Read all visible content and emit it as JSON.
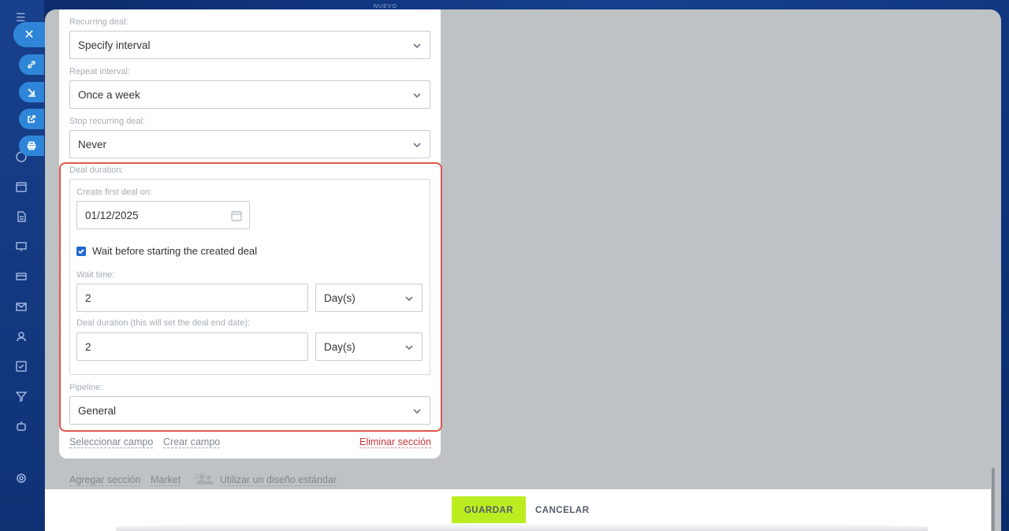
{
  "background": {
    "top_label": "NUEVO"
  },
  "form": {
    "recurring_deal": {
      "label": "Recurring deal:",
      "value": "Specify interval"
    },
    "repeat_interval": {
      "label": "Repeat interval:",
      "value": "Once a week"
    },
    "stop_recurring": {
      "label": "Stop recurring deal:",
      "value": "Never"
    },
    "deal_duration": {
      "label": "Deal duration:",
      "create_first_label": "Create first deal on:",
      "create_first_value": "01/12/2025",
      "wait_checkbox_label": "Wait before starting the created deal",
      "wait_checked": true,
      "wait_time_label": "Wait time:",
      "wait_time_value": "2",
      "wait_time_unit": "Day(s)",
      "duration_label": "Deal duration (this will set the deal end date):",
      "duration_value": "2",
      "duration_unit": "Day(s)"
    },
    "pipeline": {
      "label": "Pipeline:",
      "value": "General"
    },
    "links": {
      "select_field": "Seleccionar campo",
      "create_field": "Crear campo",
      "delete_section": "Eliminar sección"
    }
  },
  "bottom_links": {
    "add_section": "Agregar sección",
    "market": "Market",
    "use_default": "Utilizar un diseño estándar"
  },
  "footer": {
    "save": "GUARDAR",
    "cancel": "CANCELAR"
  },
  "colors": {
    "accent_blue": "#2f86d8",
    "save_green": "#bbed21",
    "highlight_red": "#e0574c"
  }
}
